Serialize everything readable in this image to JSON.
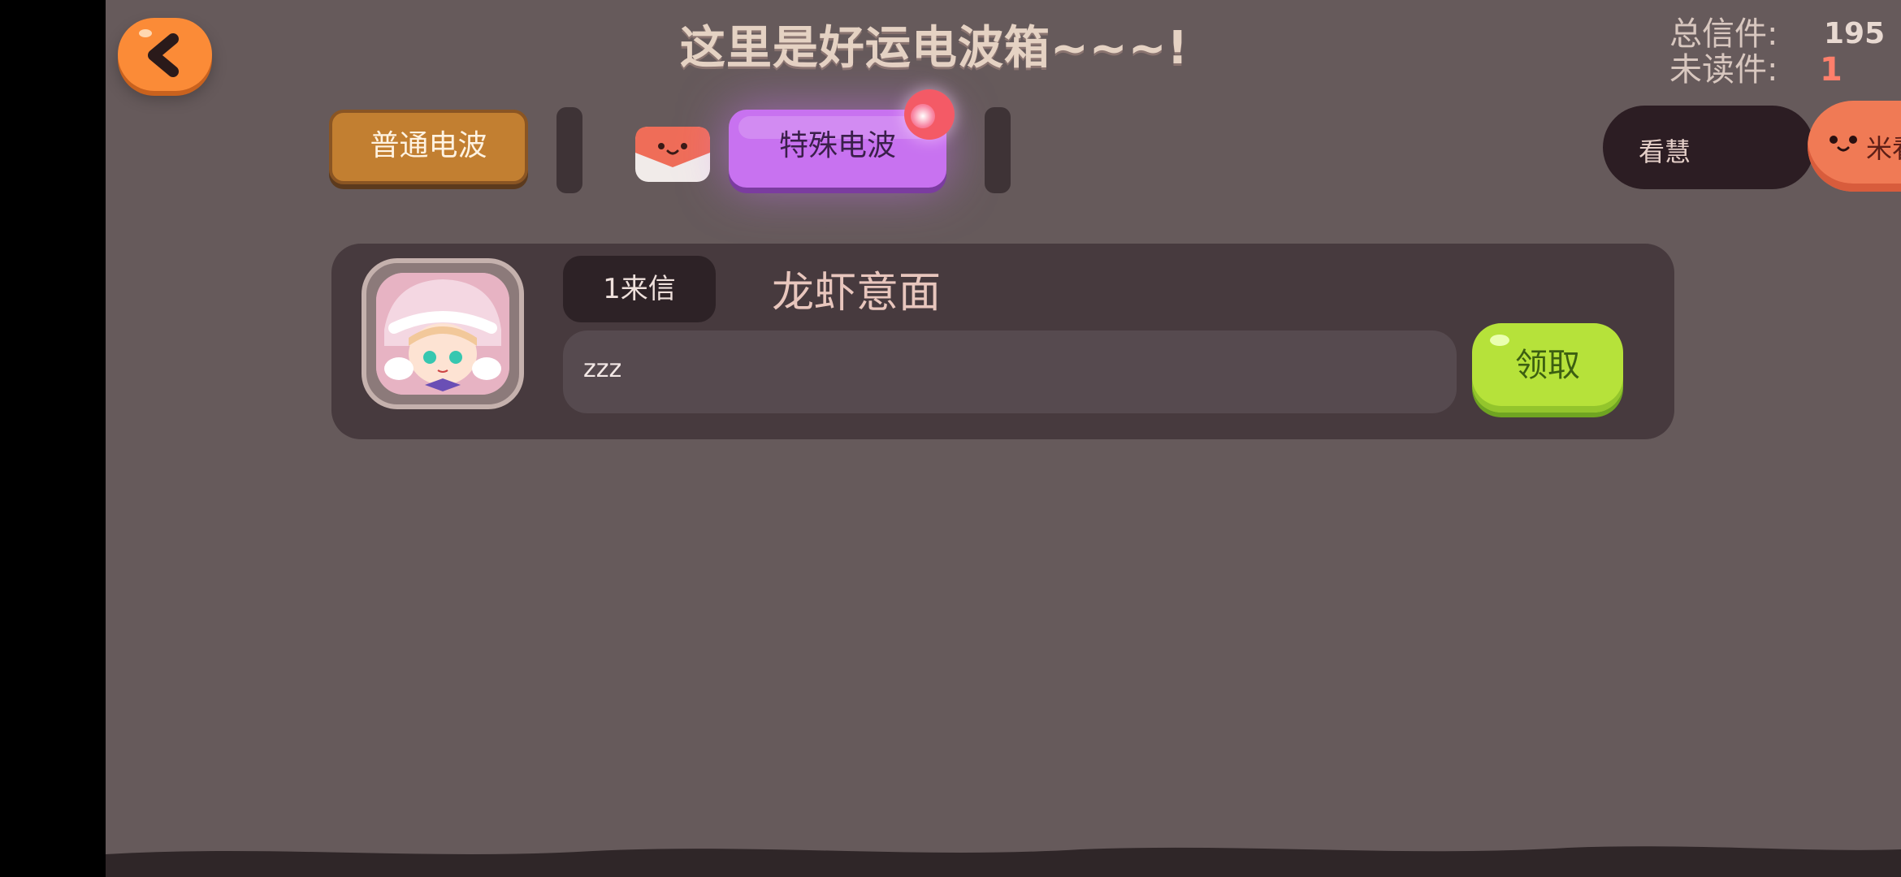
{
  "header": {
    "title": "这里是好运电波箱~~~!",
    "stats": {
      "total_label": "总信件:",
      "total_value": "195",
      "unread_label": "未读件:",
      "unread_value": "1"
    }
  },
  "tabs": {
    "normal_label": "普通电波",
    "special_label": "特殊电波"
  },
  "ad_button": {
    "left_text": "看慧",
    "right_text": "米看"
  },
  "mail": {
    "badge": "1来信",
    "sender": "龙虾意面",
    "message": "zzz",
    "claim_label": "领取"
  },
  "colors": {
    "background": "#665a5b",
    "back_button": "#fb8b37",
    "special_tab": "#c872f0",
    "claim_button": "#b6e23a",
    "unread_value": "#ff7f6b"
  },
  "icons": [
    "back-chevron-icon",
    "envelope-icon",
    "notification-dot-icon",
    "mascot-icon",
    "avatar-image"
  ]
}
